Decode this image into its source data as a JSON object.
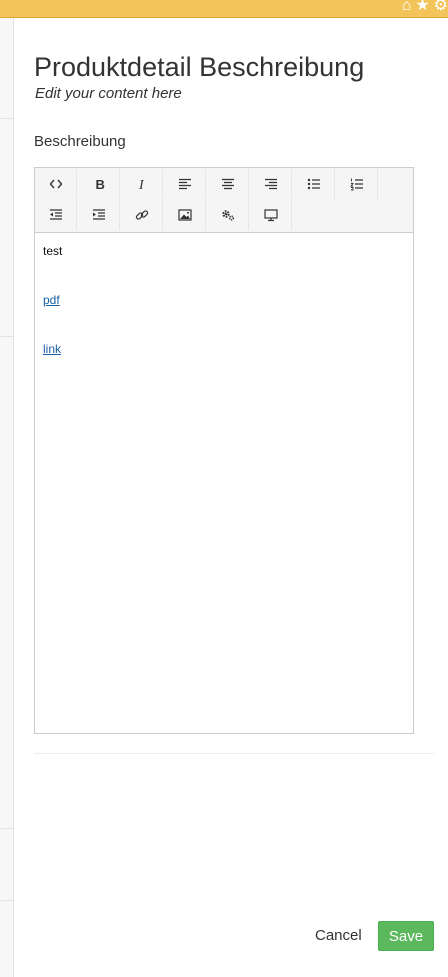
{
  "header": {
    "icons": [
      "home-icon",
      "star-icon",
      "gear-icon"
    ],
    "accent_color": "#f2c45a"
  },
  "dialog": {
    "title": "Produktdetail Beschreibung",
    "subtitle": "Edit your content here"
  },
  "field": {
    "label": "Beschreibung"
  },
  "toolbar": {
    "row1": [
      "code-view-icon",
      "bold-icon",
      "italic-icon",
      "align-left-icon",
      "align-center-icon",
      "align-right-icon",
      "bullet-list-icon",
      "numbered-list-icon"
    ],
    "row2": [
      "outdent-icon",
      "indent-icon",
      "link-icon",
      "image-icon",
      "settings-icon",
      "preview-icon"
    ]
  },
  "editor": {
    "lines": [
      {
        "type": "text",
        "text": "test"
      },
      {
        "type": "link",
        "text": "pdf"
      },
      {
        "type": "link",
        "text": "link"
      }
    ]
  },
  "actions": {
    "cancel_label": "Cancel",
    "save_label": "Save",
    "save_color": "#5cb85c"
  }
}
